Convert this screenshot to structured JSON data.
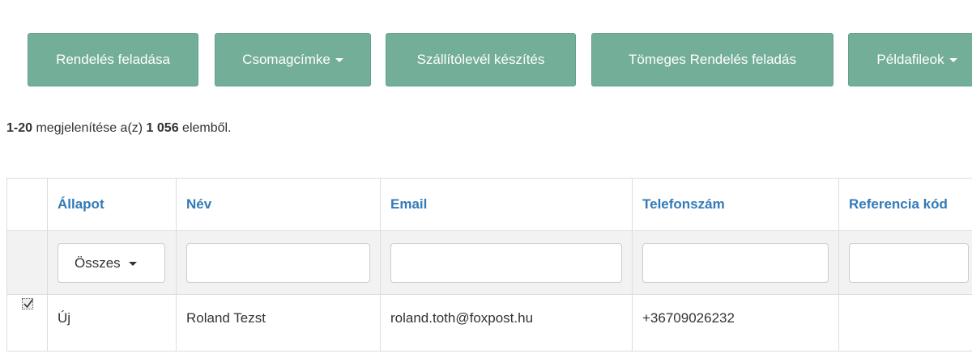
{
  "toolbar": {
    "buttons": [
      {
        "label": "Rendelés feladása",
        "dropdown": false
      },
      {
        "label": "Csomagcímke",
        "dropdown": true
      },
      {
        "label": "Szállítólevél készítés",
        "dropdown": false
      },
      {
        "label": "Tömeges Rendelés feladás",
        "dropdown": false
      },
      {
        "label": "Példafileok",
        "dropdown": true
      }
    ],
    "accent_color": "#73ae99"
  },
  "summary": {
    "range": "1-20",
    "mid_text": " megjelenítése a(z) ",
    "total": "1 056",
    "end_text": " elemből."
  },
  "table": {
    "headers": [
      "Állapot",
      "Név",
      "Email",
      "Telefonszám",
      "Referencia kód"
    ],
    "header_color": "#337ab7",
    "filters": {
      "status_selected": "Összes",
      "name": "",
      "email": "",
      "phone": "",
      "reference": ""
    },
    "rows": [
      {
        "checked": true,
        "status": "Új",
        "name": "Roland Tezst",
        "email": "roland.toth@foxpost.hu",
        "phone": "+36709026232",
        "reference": ""
      }
    ]
  }
}
